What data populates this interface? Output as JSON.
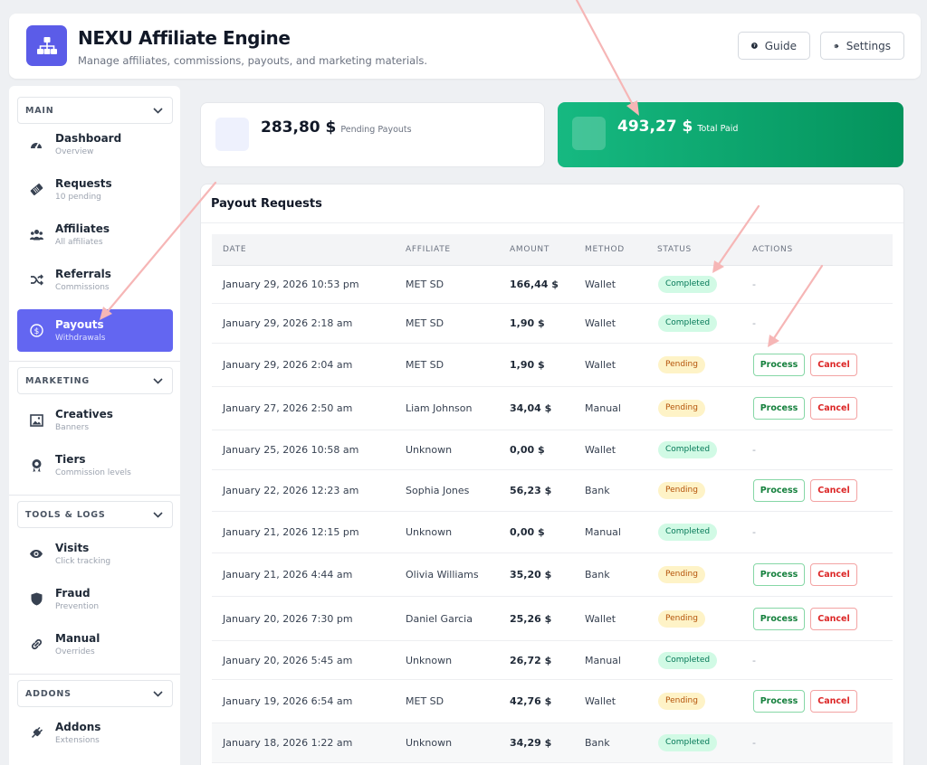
{
  "header": {
    "title": "NEXU Affiliate Engine",
    "subtitle": "Manage affiliates, commissions, payouts, and marketing materials.",
    "guide_label": "Guide",
    "settings_label": "Settings"
  },
  "sidebar": {
    "sections": [
      {
        "title": "MAIN",
        "items": [
          {
            "label": "Dashboard",
            "sub": "Overview",
            "icon": "gauge-icon"
          },
          {
            "label": "Requests",
            "sub": "10 pending",
            "icon": "ticket-icon"
          },
          {
            "label": "Affiliates",
            "sub": "All affiliates",
            "icon": "users-icon"
          },
          {
            "label": "Referrals",
            "sub": "Commissions",
            "icon": "shuffle-icon"
          },
          {
            "label": "Payouts",
            "sub": "Withdrawals",
            "icon": "dollar-circle-icon",
            "active": true
          }
        ]
      },
      {
        "title": "MARKETING",
        "items": [
          {
            "label": "Creatives",
            "sub": "Banners",
            "icon": "image-icon"
          },
          {
            "label": "Tiers",
            "sub": "Commission levels",
            "icon": "award-icon"
          }
        ]
      },
      {
        "title": "TOOLS & LOGS",
        "items": [
          {
            "label": "Visits",
            "sub": "Click tracking",
            "icon": "eye-icon"
          },
          {
            "label": "Fraud",
            "sub": "Prevention",
            "icon": "shield-icon"
          },
          {
            "label": "Manual",
            "sub": "Overrides",
            "icon": "link-icon"
          }
        ]
      },
      {
        "title": "ADDONS",
        "items": [
          {
            "label": "Addons",
            "sub": "Extensions",
            "icon": "plug-icon"
          }
        ]
      }
    ]
  },
  "stats": {
    "pending": {
      "value": "283,80 $",
      "label": "Pending Payouts"
    },
    "paid": {
      "value": "493,27 $",
      "label": "Total Paid"
    }
  },
  "table": {
    "title": "Payout Requests",
    "columns": [
      "DATE",
      "AFFILIATE",
      "AMOUNT",
      "METHOD",
      "STATUS",
      "ACTIONS"
    ],
    "process_label": "Process",
    "cancel_label": "Cancel",
    "empty_action": "-",
    "rows": [
      {
        "date": "January 29, 2026 10:53 pm",
        "affiliate": "MET SD",
        "amount": "166,44 $",
        "method": "Wallet",
        "status": "Completed"
      },
      {
        "date": "January 29, 2026 2:18 am",
        "affiliate": "MET SD",
        "amount": "1,90 $",
        "method": "Wallet",
        "status": "Completed"
      },
      {
        "date": "January 29, 2026 2:04 am",
        "affiliate": "MET SD",
        "amount": "1,90 $",
        "method": "Wallet",
        "status": "Pending"
      },
      {
        "date": "January 27, 2026 2:50 am",
        "affiliate": "Liam Johnson",
        "amount": "34,04 $",
        "method": "Manual",
        "status": "Pending"
      },
      {
        "date": "January 25, 2026 10:58 am",
        "affiliate": "Unknown",
        "amount": "0,00 $",
        "method": "Wallet",
        "status": "Completed"
      },
      {
        "date": "January 22, 2026 12:23 am",
        "affiliate": "Sophia Jones",
        "amount": "56,23 $",
        "method": "Bank",
        "status": "Pending"
      },
      {
        "date": "January 21, 2026 12:15 pm",
        "affiliate": "Unknown",
        "amount": "0,00 $",
        "method": "Manual",
        "status": "Completed"
      },
      {
        "date": "January 21, 2026 4:44 am",
        "affiliate": "Olivia Williams",
        "amount": "35,20 $",
        "method": "Bank",
        "status": "Pending"
      },
      {
        "date": "January 20, 2026 7:30 pm",
        "affiliate": "Daniel Garcia",
        "amount": "25,26 $",
        "method": "Wallet",
        "status": "Pending"
      },
      {
        "date": "January 20, 2026 5:45 am",
        "affiliate": "Unknown",
        "amount": "26,72 $",
        "method": "Manual",
        "status": "Completed"
      },
      {
        "date": "January 19, 2026 6:54 am",
        "affiliate": "MET SD",
        "amount": "42,76 $",
        "method": "Wallet",
        "status": "Pending"
      },
      {
        "date": "January 18, 2026 1:22 am",
        "affiliate": "Unknown",
        "amount": "34,29 $",
        "method": "Bank",
        "status": "Completed"
      }
    ]
  },
  "colors": {
    "accent": "#6366f1",
    "success": "#10b981",
    "annotation_arrow": "#f6b6b6"
  }
}
